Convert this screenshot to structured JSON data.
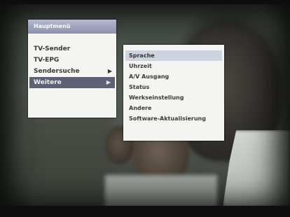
{
  "main_menu": {
    "title": "Hauptmenü",
    "items": [
      {
        "label": "TV-Sender",
        "arrow": ""
      },
      {
        "label": "TV-EPG",
        "arrow": ""
      },
      {
        "label": "Sendersuche",
        "arrow": "▶"
      },
      {
        "label": "Weitere",
        "arrow": "▶"
      }
    ],
    "selected_index": 3
  },
  "sub_menu": {
    "items": [
      "Sprache",
      "Uhrzeit",
      "A/V Ausgang",
      "Status",
      "Werkseinstellung",
      "Andere",
      "Software-Aktualisierung"
    ],
    "selected_index": 0
  },
  "colors": {
    "header": "#8b90ad",
    "selected_main": "#5c6375",
    "selected_sub": "#cfd3e0",
    "menu_bg": "#f4f5f3"
  }
}
